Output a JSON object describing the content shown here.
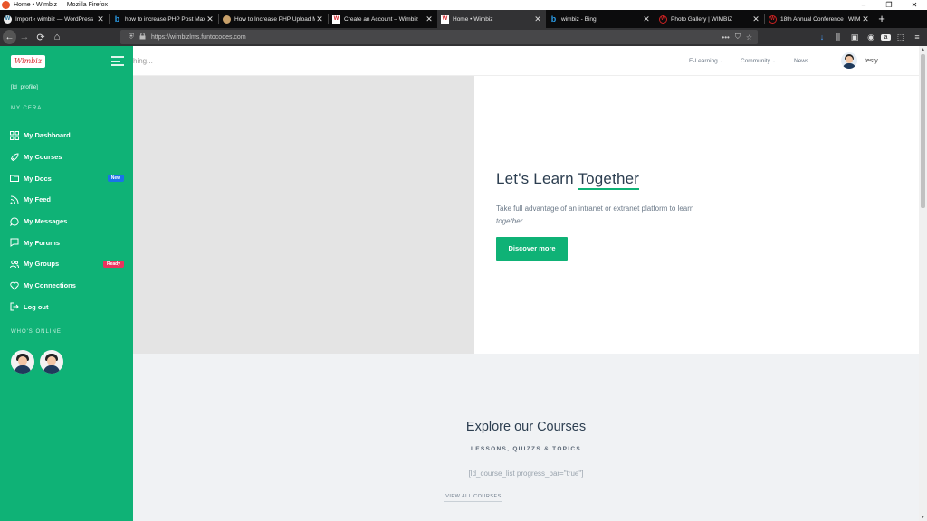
{
  "window": {
    "title": "Home • Wimbiz — Mozilla Firefox",
    "controls": {
      "minimize": "–",
      "maximize": "❐",
      "close": "✕"
    }
  },
  "tabs": [
    {
      "label": "Import ‹ wimbiz — WordPress",
      "icon": "wordpress-icon",
      "active": false
    },
    {
      "label": "how to increase PHP Post Max",
      "icon": "bing-icon",
      "active": false
    },
    {
      "label": "How to Increase PHP Upload M",
      "icon": "site-icon",
      "active": false
    },
    {
      "label": "Create an Account – Wimbiz",
      "icon": "wimbiz-icon",
      "active": false
    },
    {
      "label": "Home • Wimbiz",
      "icon": "wimbiz-icon",
      "active": true
    },
    {
      "label": "wimbiz - Bing",
      "icon": "bing-icon",
      "active": false
    },
    {
      "label": "Photo Gallery | WIMBIZ",
      "icon": "wimbiz-red-icon",
      "active": false
    },
    {
      "label": "18th Annual Conference | WIM",
      "icon": "wimbiz-red-icon",
      "active": false
    }
  ],
  "tab_close": "✕",
  "new_tab": "+",
  "nav": {
    "url": "https://wimbizlms.funtocodes.com",
    "icons": {
      "back": "←",
      "forward": "→",
      "reload": "⟳",
      "home": "⌂",
      "more": "•••",
      "pocket": "⛉",
      "bookmark": "☆",
      "shield": "⛨",
      "lock": "🔒"
    }
  },
  "toolbar_icons": [
    "↓",
    "⫼",
    "▣",
    "◉",
    "a",
    "⬚",
    "≡"
  ],
  "sidebar": {
    "logo_text": "Wimbiz",
    "profile_shortcode": "[ld_profile]",
    "section_my": "MY CERA",
    "items": [
      {
        "label": "My Dashboard",
        "icon": "grid-icon"
      },
      {
        "label": "My Courses",
        "icon": "rocket-icon"
      },
      {
        "label": "My Docs",
        "icon": "folder-icon",
        "badge": "New"
      },
      {
        "label": "My Feed",
        "icon": "rss-icon"
      },
      {
        "label": "My Messages",
        "icon": "message-icon"
      },
      {
        "label": "My Forums",
        "icon": "forum-icon"
      },
      {
        "label": "My Groups",
        "icon": "users-icon",
        "badge": "Ready"
      },
      {
        "label": "My Connections",
        "icon": "heart-icon"
      },
      {
        "label": "Log out",
        "icon": "logout-icon"
      }
    ],
    "section_online": "WHO'S ONLINE"
  },
  "header": {
    "search_placeholder": "hing...",
    "nav": [
      {
        "label": "E-Learning",
        "dropdown": true
      },
      {
        "label": "Community",
        "dropdown": true
      },
      {
        "label": "News",
        "dropdown": false
      }
    ],
    "chevron": "⌄",
    "user": "testy"
  },
  "hero": {
    "title_a": "Let's Learn ",
    "title_b": "Together",
    "text_a": "Take full advantage of an intranet or extranet platform to learn ",
    "text_b": "together",
    "text_c": ".",
    "button": "Discover more"
  },
  "courses": {
    "title": "Explore our Courses",
    "subtitle": "LESSONS, QUIZZS & TOPICS",
    "shortcode": "[ld_course_list progress_bar=\"true\"]",
    "view_all": "VIEW ALL COURSES"
  },
  "colors": {
    "brand": "#0fb276",
    "badge_new": "#1a73e8",
    "badge_ready": "#e8335d",
    "dark_text": "#2c3e50"
  }
}
